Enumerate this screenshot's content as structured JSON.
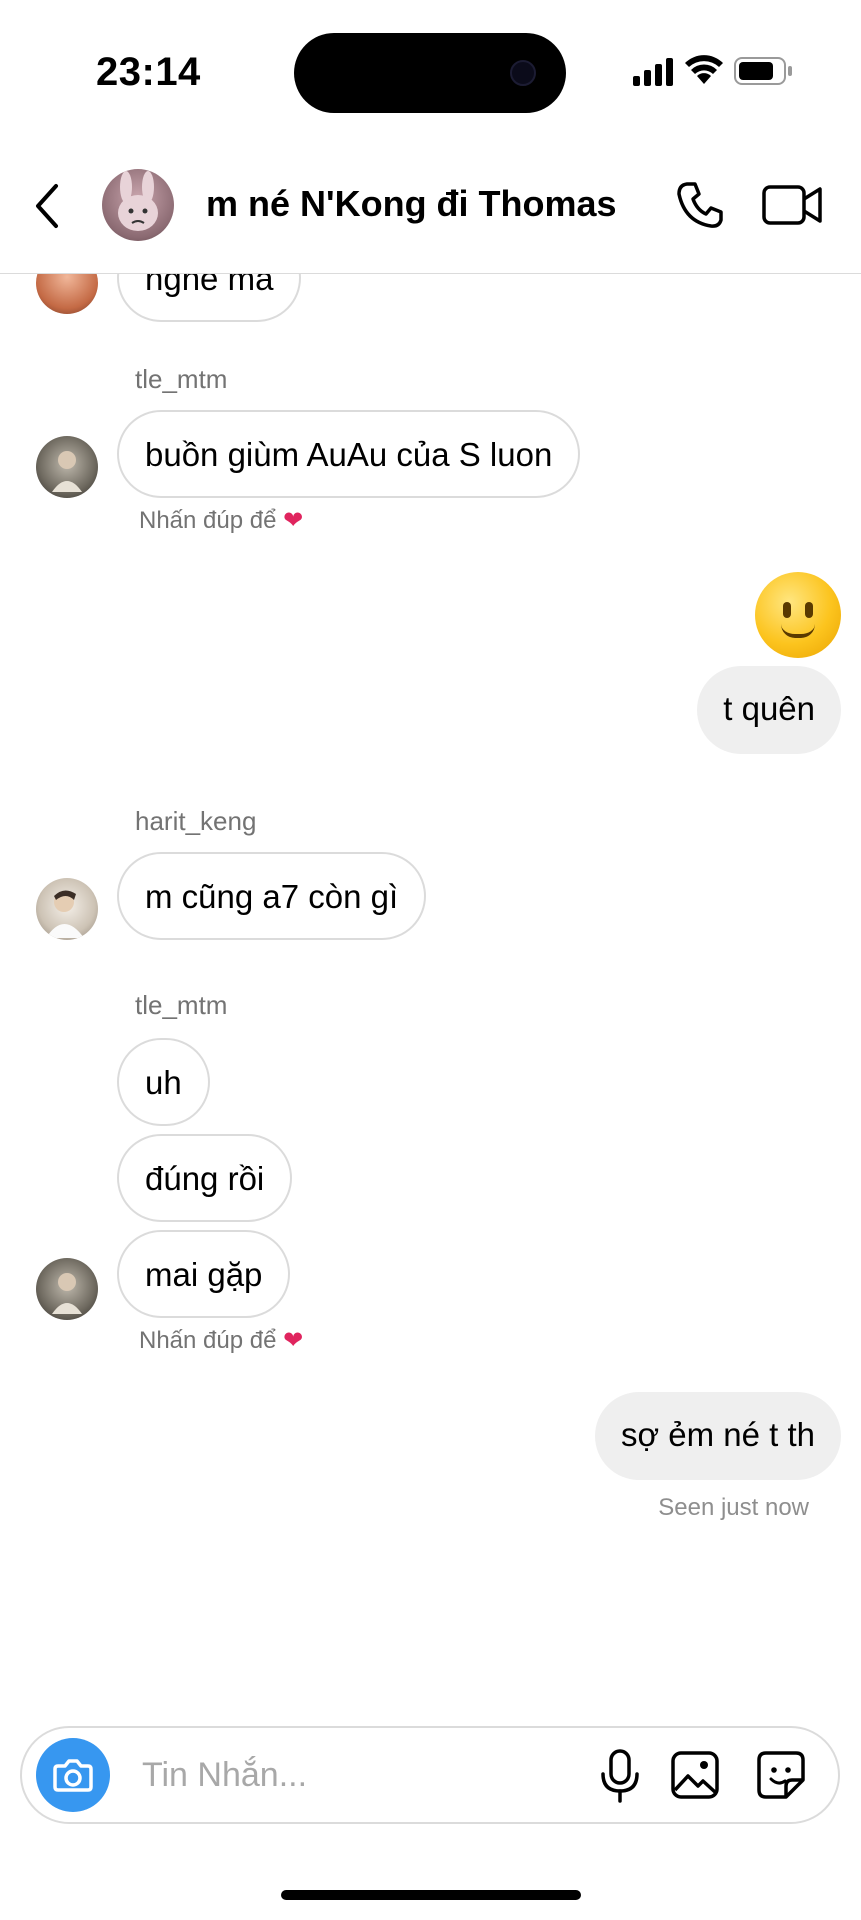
{
  "status_bar": {
    "time": "23:14"
  },
  "header": {
    "title": "m né N'Kong đi Thomas"
  },
  "messages": [
    {
      "type": "incoming",
      "text": "nghe mà"
    },
    {
      "type": "username",
      "text": "tle_mtm"
    },
    {
      "type": "incoming",
      "text": "buồn giùm AuAu của S luon"
    },
    {
      "type": "hint",
      "text": "Nhấn đúp để",
      "icon": "heart-icon"
    },
    {
      "type": "outgoing-emoji",
      "icon": "slightly-smiling-face-emoji"
    },
    {
      "type": "outgoing",
      "text": "t quên"
    },
    {
      "type": "username",
      "text": "harit_keng"
    },
    {
      "type": "incoming",
      "text": "m cũng a7 còn gì"
    },
    {
      "type": "username",
      "text": "tle_mtm"
    },
    {
      "type": "incoming",
      "text": "uh"
    },
    {
      "type": "incoming",
      "text": "đúng rồi"
    },
    {
      "type": "incoming",
      "text": "mai gặp"
    },
    {
      "type": "hint",
      "text": "Nhấn đúp để",
      "icon": "heart-icon"
    },
    {
      "type": "outgoing",
      "text": "sợ ẻm né t th"
    },
    {
      "type": "seen",
      "text": "Seen just now"
    }
  ],
  "composer": {
    "placeholder": "Tin Nhắn..."
  },
  "colors": {
    "accent": "#3797f0",
    "heart": "#e0245e",
    "incoming_border": "#dbdbdb",
    "outgoing_bg": "#efefef"
  }
}
